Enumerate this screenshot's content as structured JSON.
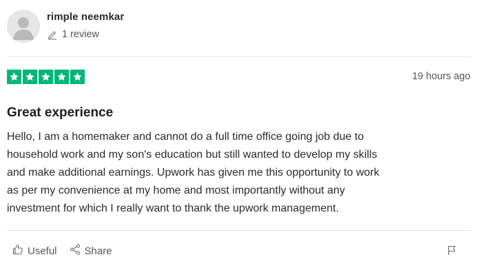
{
  "reviewer": {
    "name": "rimple neemkar",
    "review_count": "1 review",
    "avatar_icon": "default-user-avatar"
  },
  "rating": {
    "stars": 5,
    "max_stars": 5,
    "color": "#00b67a",
    "date": "19 hours ago"
  },
  "review": {
    "title": "Great experience",
    "lines": [
      "Hello, I am a homemaker and cannot do a full time office going job due to",
      "household work and my son's education but still wanted to develop my skills",
      "and make additional earnings. Upwork has given me this opportunity to work",
      "as per my convenience at my home and most importantly without any",
      "investment for which I really want to thank the upwork management."
    ]
  },
  "actions": {
    "useful_label": "Useful",
    "share_label": "Share",
    "useful_icon": "thumbs-up-icon",
    "share_icon": "share-icon",
    "report_icon": "flag-icon"
  },
  "colors": {
    "text_primary": "#1e1e1e",
    "text_muted": "#555555",
    "divider": "#e4e4e4"
  }
}
